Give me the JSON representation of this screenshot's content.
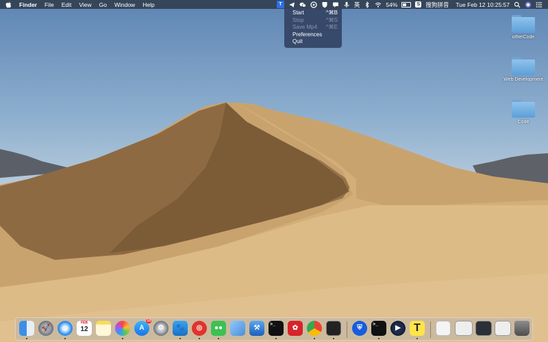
{
  "menubar": {
    "app_name": "Finder",
    "menus": [
      "File",
      "Edit",
      "View",
      "Go",
      "Window",
      "Help"
    ],
    "battery": "54%",
    "ime_label": "搜狗拼音",
    "ime_char": "英",
    "clock": "Tue Feb 12  10:25:57"
  },
  "dropdown": {
    "items": [
      {
        "label": "Start",
        "shortcut": "^⌘B",
        "enabled": true
      },
      {
        "label": "Stop",
        "shortcut": "^⌘S",
        "enabled": false
      },
      {
        "label": "Save Mp4",
        "shortcut": "^⌘E",
        "enabled": false
      },
      {
        "label": "Preferences",
        "shortcut": "",
        "enabled": true
      },
      {
        "label": "Quit",
        "shortcut": "",
        "enabled": true
      }
    ]
  },
  "desktop": {
    "folders": [
      "otherCode",
      "Web Development",
      "Code"
    ]
  },
  "dock": {
    "calendar_month": "FEB",
    "calendar_day": "12",
    "appstore_badge": "13",
    "apps": [
      "finder-icon",
      "launchpad-icon",
      "safari-icon",
      "calendar-icon",
      "notes-icon",
      "photos-icon",
      "app-store-icon",
      "system-preferences-icon",
      "paw-icon",
      "netease-music-icon",
      "wechat-icon",
      "preview-icon",
      "xcode-icon",
      "terminal-icon",
      "huawei-icon",
      "chrome-icon",
      "activity-monitor-icon",
      "bitwarden-icon",
      "terminal-2-icon",
      "quicktime-icon",
      "typora-icon",
      "document-thumb-icon",
      "screenshot-thumb-icon",
      "screenshot-thumb-icon",
      "screenshot-thumb-icon",
      "trash-icon"
    ]
  }
}
